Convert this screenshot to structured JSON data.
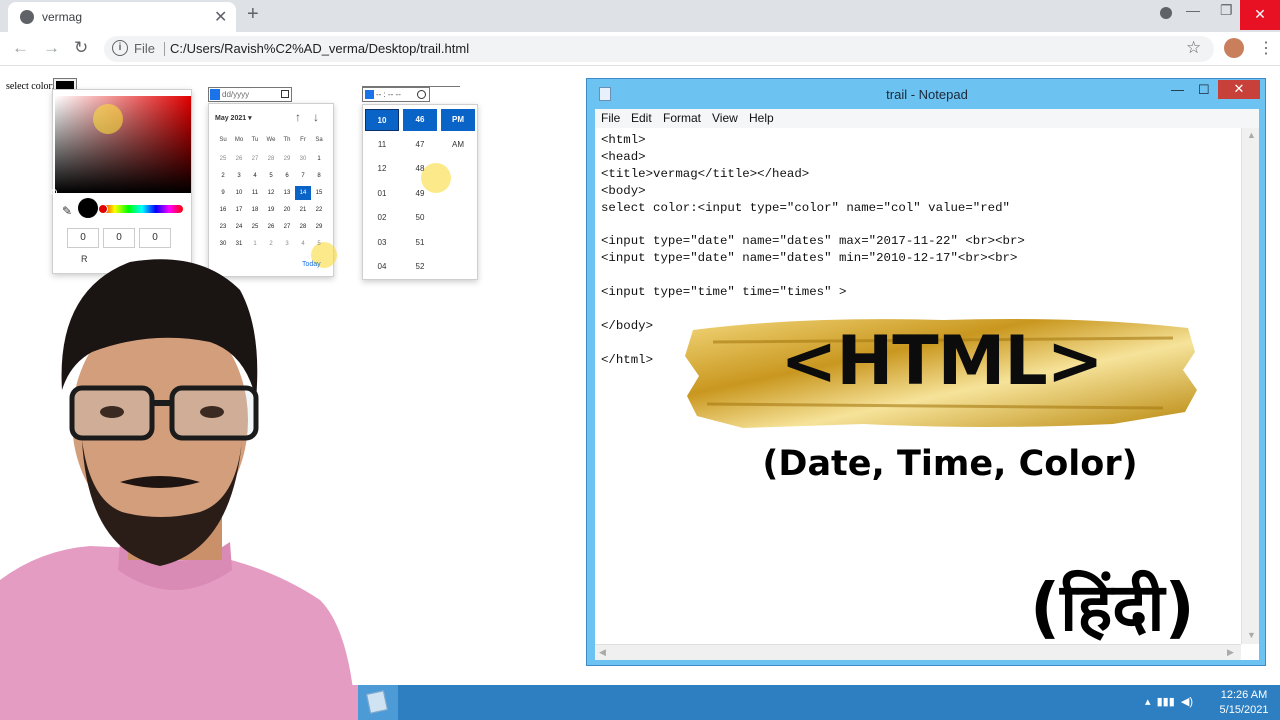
{
  "browser": {
    "tab_title": "vermag",
    "new_tab_symbol": "+",
    "scheme_label": "File",
    "url": "C:/Users/Ravish%C2%AD_verma/Desktop/trail.html"
  },
  "page": {
    "color_label": "select color:",
    "color_value": "#000000",
    "color_popup": {
      "r": "0",
      "g": "0",
      "b": "0",
      "mode_label": "R"
    },
    "date_placeholder": "dd/yyyy",
    "calendar": {
      "month_label": "May 2021 ▾",
      "weekdays": [
        "Su",
        "Mo",
        "Tu",
        "We",
        "Th",
        "Fr",
        "Sa"
      ],
      "weeks": [
        [
          "25",
          "26",
          "27",
          "28",
          "29",
          "30",
          "1"
        ],
        [
          "2",
          "3",
          "4",
          "5",
          "6",
          "7",
          "8"
        ],
        [
          "9",
          "10",
          "11",
          "12",
          "13",
          "14",
          "15"
        ],
        [
          "16",
          "17",
          "18",
          "19",
          "20",
          "21",
          "22"
        ],
        [
          "23",
          "24",
          "25",
          "26",
          "27",
          "28",
          "29"
        ],
        [
          "30",
          "31",
          "1",
          "2",
          "3",
          "4",
          "5"
        ]
      ],
      "selected_day": "14",
      "today_label": "Today"
    },
    "time_placeholder": "-- : -- --",
    "time_picker": {
      "hours": [
        "10",
        "11",
        "12",
        "01",
        "02",
        "03",
        "04"
      ],
      "minutes": [
        "46",
        "47",
        "48",
        "49",
        "50",
        "51",
        "52"
      ],
      "periods": [
        "PM",
        "AM"
      ]
    }
  },
  "notepad": {
    "title": "trail - Notepad",
    "menu": [
      "File",
      "Edit",
      "Format",
      "View",
      "Help"
    ],
    "code": "<html>\n<head>\n<title>vermag</title></head>\n<body>\nselect color:<input type=\"color\" name=\"col\" value=\"red\"\n\n<input type=\"date\" name=\"dates\" max=\"2017-11-22\" <br><br>\n<input type=\"date\" name=\"dates\" min=\"2010-12-17\"<br><br>\n\n<input type=\"time\" time=\"times\" >\n\n</body>\n\n</html>"
  },
  "overlay": {
    "title": "<HTML>",
    "subtitle": "(Date, Time, Color)",
    "language": "(हिंदी)"
  },
  "taskbar": {
    "time": "12:26 AM",
    "date": "5/15/2021"
  },
  "colors": {
    "chrome_bg": "#dee1e6",
    "notepad_frame": "#6cc2f0",
    "taskbar": "#2d7fc1",
    "selected_blue": "#0a64c8",
    "gold": "#d4a62a"
  },
  "icons": [
    "globe-icon",
    "close-icon",
    "back-icon",
    "forward-icon",
    "reload-icon",
    "info-icon",
    "star-icon",
    "menu-icon",
    "eyedropper-icon",
    "calendar-icon",
    "clock-icon",
    "notepad-icon"
  ]
}
